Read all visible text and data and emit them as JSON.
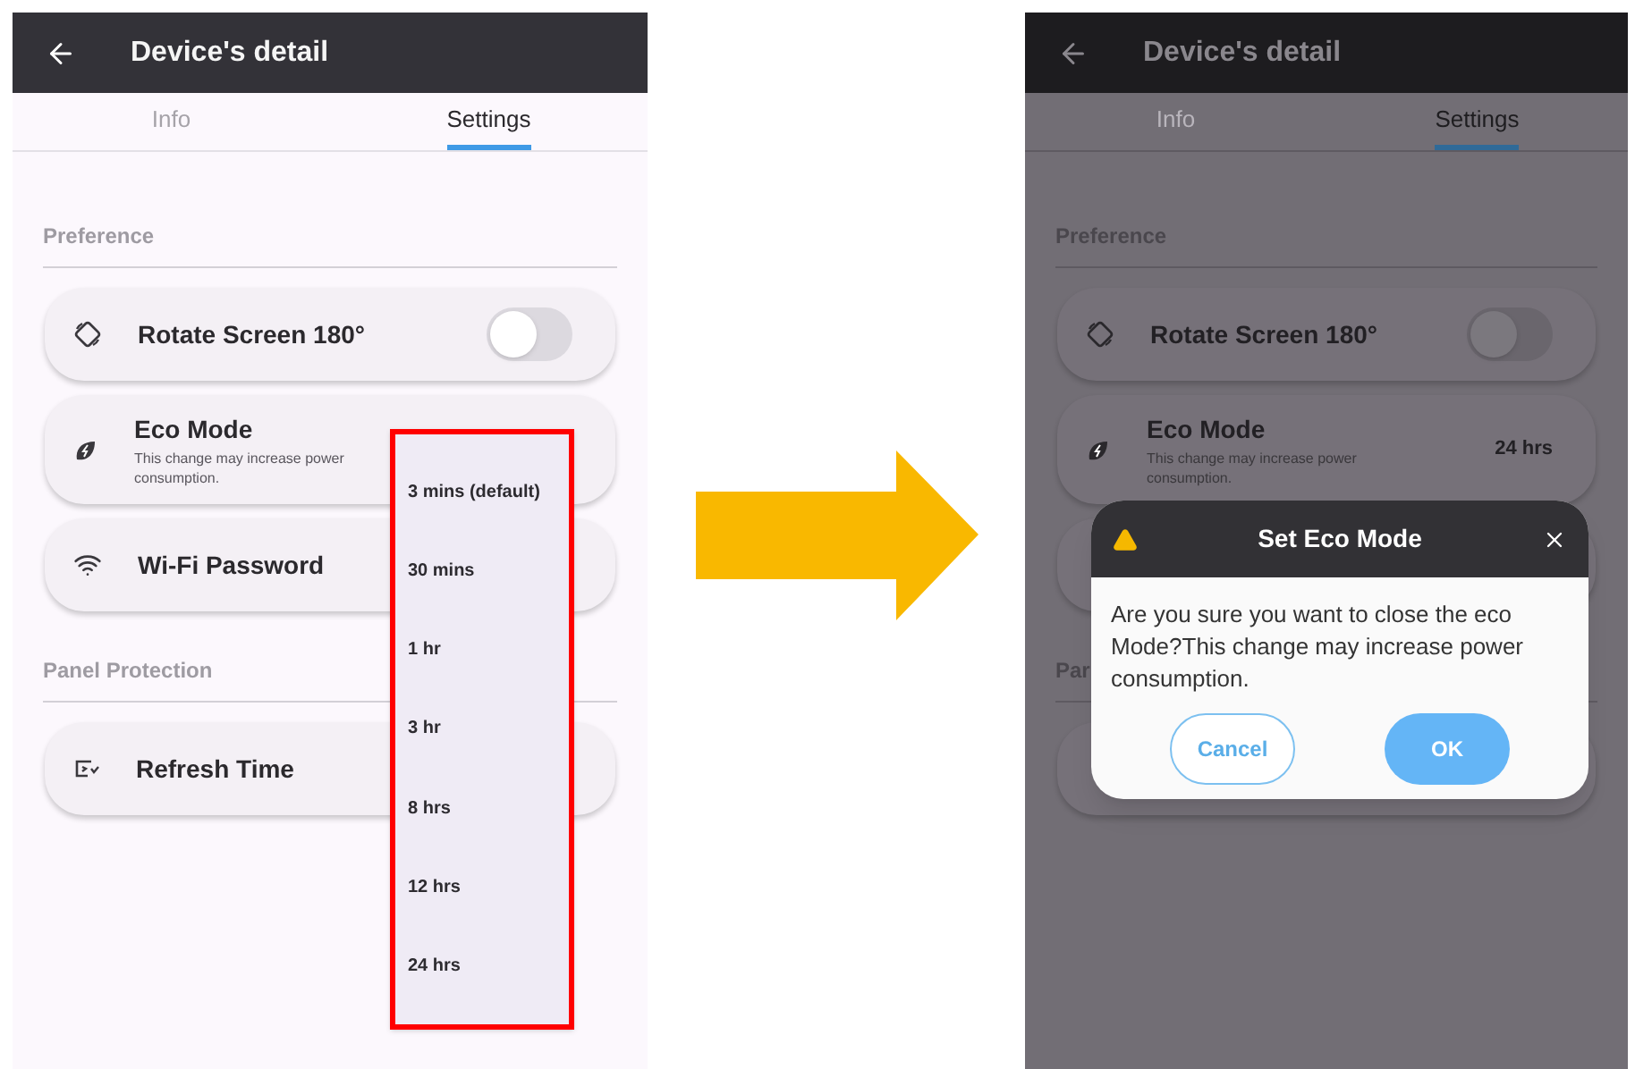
{
  "screens": [
    {
      "dimmed": false,
      "header": {
        "title": "Device's detail"
      },
      "tabs": [
        {
          "label": "Info",
          "selected": false
        },
        {
          "label": "Settings",
          "selected": true
        }
      ],
      "sections": [
        {
          "title": "Preference",
          "items": [
            {
              "kind": "toggle",
              "label": "Rotate Screen 180°",
              "on": false
            },
            {
              "kind": "select",
              "label": "Eco Mode",
              "description": "This change may increase power consumption."
            },
            {
              "kind": "link",
              "label": "Wi-Fi Password"
            }
          ]
        },
        {
          "title": "Panel Protection",
          "items": [
            {
              "kind": "link",
              "label": "Refresh Time"
            }
          ]
        }
      ],
      "dropdown": {
        "options": [
          "3 mins (default)",
          "30 mins",
          "1 hr",
          "3 hr",
          "8 hrs",
          "12 hrs",
          "24 hrs"
        ]
      }
    },
    {
      "dimmed": true,
      "header": {
        "title": "Device's detail"
      },
      "tabs": [
        {
          "label": "Info",
          "selected": false
        },
        {
          "label": "Settings",
          "selected": true
        }
      ],
      "sections": [
        {
          "title": "Preference",
          "items": [
            {
              "kind": "toggle",
              "label": "Rotate Screen 180°",
              "on": false
            },
            {
              "kind": "select",
              "label": "Eco Mode",
              "description": "This change may increase power consumption.",
              "value": "24 hrs"
            },
            {
              "kind": "link"
            }
          ]
        },
        {
          "title": "Par",
          "items": [
            {
              "kind": "link"
            }
          ]
        }
      ],
      "dialog": {
        "title": "Set Eco Mode",
        "message": "Are you sure you want to close the eco Mode?This change may increase power consumption.",
        "buttons": [
          {
            "label": "Cancel",
            "kind": "outline"
          },
          {
            "label": "OK",
            "kind": "filled"
          }
        ]
      }
    }
  ]
}
